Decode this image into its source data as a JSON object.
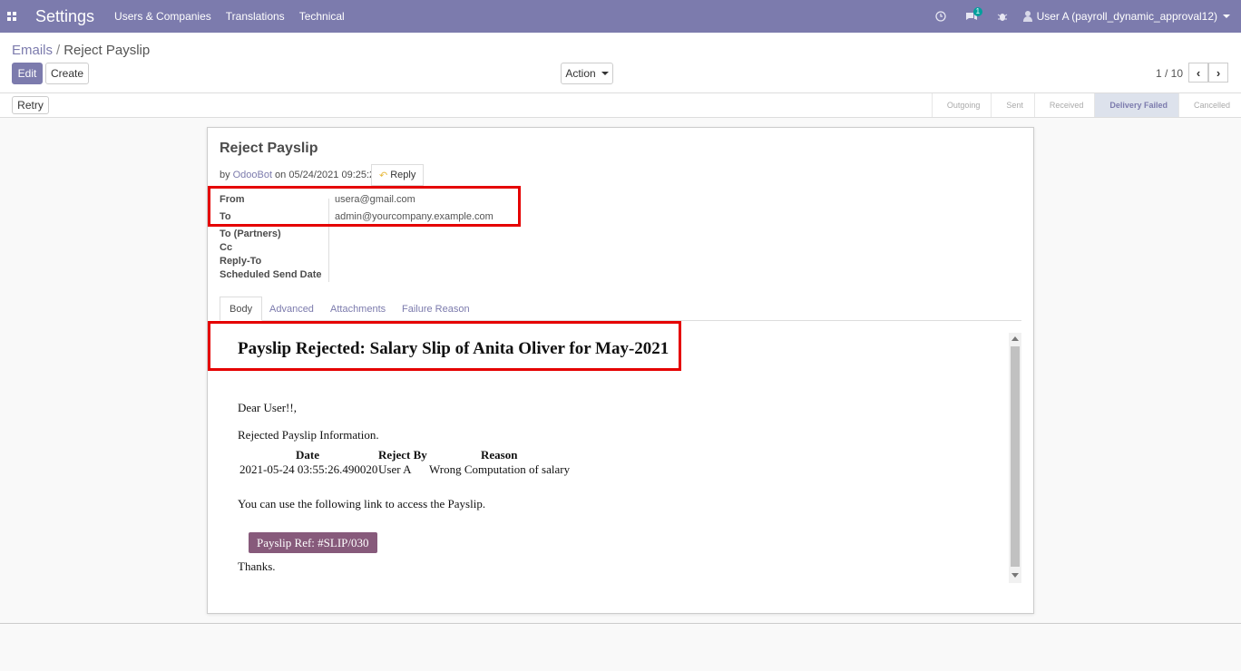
{
  "navbar": {
    "app_title": "Settings",
    "menu": [
      "Users & Companies",
      "Translations",
      "Technical"
    ],
    "message_count": "1",
    "user_name": "User A (payroll_dynamic_approval12)",
    "icons": [
      "apps-icon",
      "clock-icon",
      "chat-icon",
      "bug-icon",
      "user-icon"
    ]
  },
  "breadcrumb": {
    "parent": "Emails",
    "current": "Reject Payslip"
  },
  "toolbar": {
    "edit_label": "Edit",
    "create_label": "Create",
    "action_label": "Action"
  },
  "pager": {
    "value": "1 / 10",
    "prev": "‹",
    "next": "›"
  },
  "statusbar": {
    "retry_label": "Retry",
    "stages": [
      "Outgoing",
      "Sent",
      "Received",
      "Delivery Failed",
      "Cancelled"
    ],
    "active_stage": "Delivery Failed"
  },
  "email": {
    "subject": "Reject Payslip",
    "by_prefix": "by",
    "author": "OdooBot",
    "on_prefix": "on",
    "date": "05/24/2021 09:25:26",
    "reply_label": "Reply",
    "fields": [
      {
        "label": "From",
        "value": "usera@gmail.com"
      },
      {
        "label": "To",
        "value": "admin@yourcompany.example.com"
      },
      {
        "label": "To (Partners)",
        "value": ""
      },
      {
        "label": "Cc",
        "value": ""
      },
      {
        "label": "Reply-To",
        "value": ""
      },
      {
        "label": "Scheduled Send Date",
        "value": ""
      }
    ]
  },
  "tabs": [
    "Body",
    "Advanced",
    "Attachments",
    "Failure Reason"
  ],
  "body": {
    "heading": "Payslip Rejected: Salary Slip of Anita Oliver for May-2021",
    "greeting": "Dear User!!,",
    "info_title": "Rejected Payslip Information.",
    "table_headers": [
      "Date",
      "Reject By",
      "Reason"
    ],
    "table_row": [
      "2021-05-24 03:55:26.490020",
      "User A",
      "Wrong Computation of salary"
    ],
    "link_text": "You can use the following link to access the Payslip.",
    "button_label": "Payslip Ref: #SLIP/030",
    "closing": "Thanks."
  },
  "colors": {
    "brand": "#7c7bad",
    "button": "#875a7b",
    "highlight": "#e50000"
  }
}
